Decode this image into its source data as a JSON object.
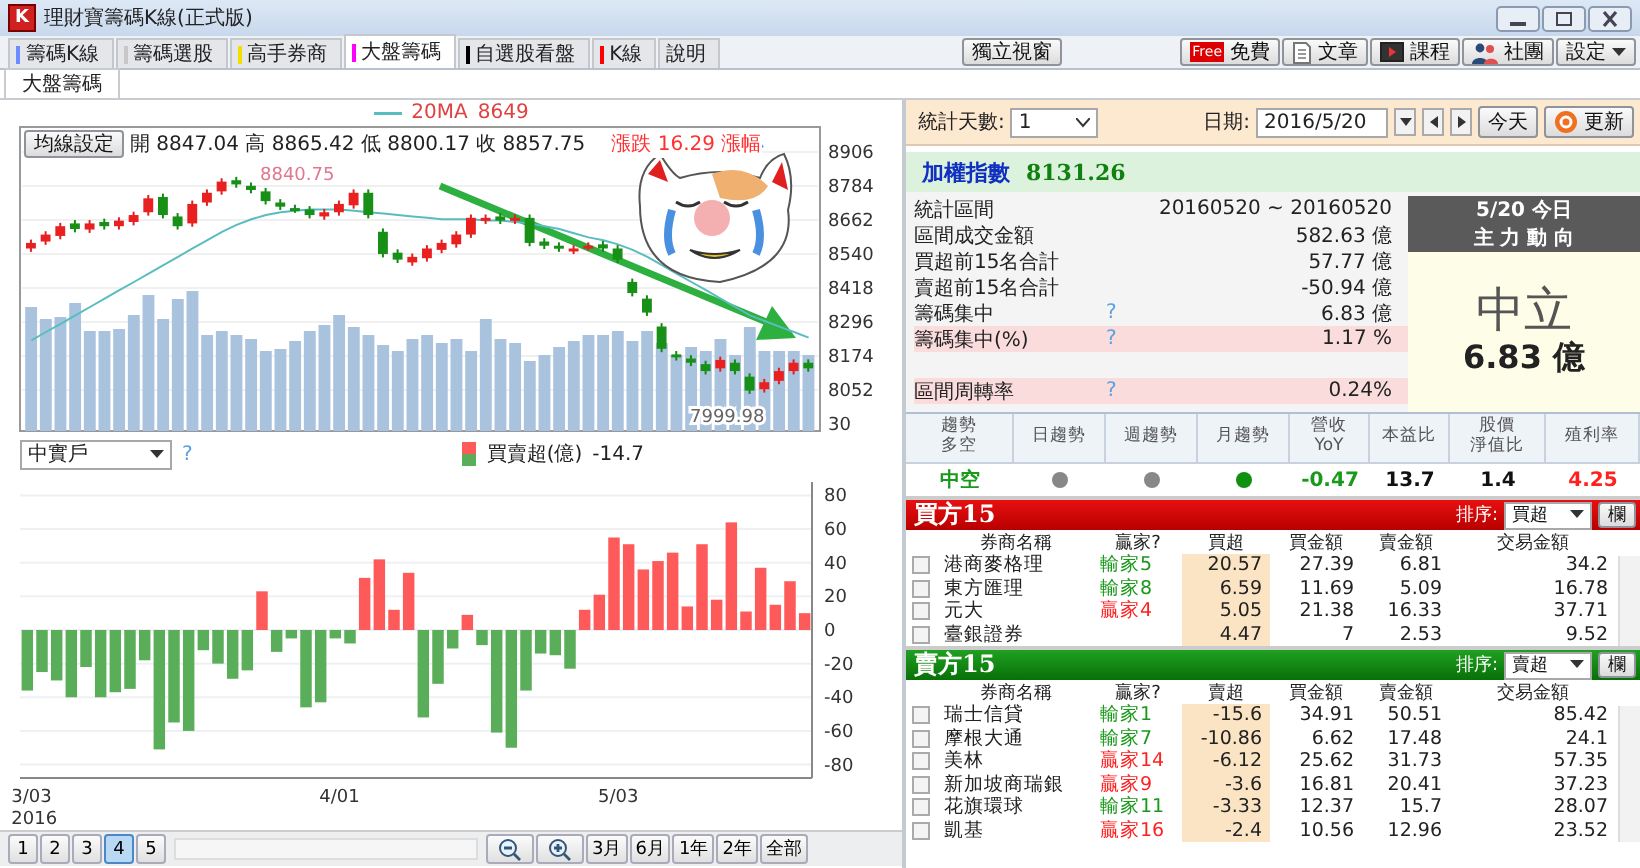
{
  "window": {
    "logo": "K",
    "title": "理財寶籌碼K線(正式版)"
  },
  "tabs": [
    {
      "label": "籌碼K線",
      "color": "#6a8cff",
      "selected": false
    },
    {
      "label": "籌碼選股",
      "color": "#c8c8c8",
      "selected": false
    },
    {
      "label": "高手券商",
      "color": "#f0e000",
      "selected": false
    },
    {
      "label": "大盤籌碼",
      "color": "#ff00ff",
      "selected": true
    },
    {
      "label": "自選股看盤",
      "color": "#000000",
      "selected": false
    },
    {
      "label": "K線",
      "color": "#ff0000",
      "selected": false
    },
    {
      "label": "說明",
      "selected": false
    }
  ],
  "popout_button": "獨立視窗",
  "toolbar_buttons": [
    {
      "kind": "free",
      "badge": "Free",
      "label": "免費"
    },
    {
      "kind": "article",
      "label": "文章"
    },
    {
      "kind": "course",
      "label": "課程"
    },
    {
      "kind": "group",
      "label": "社團"
    }
  ],
  "settings_button": "設定",
  "subtabs": [
    {
      "label": "大盤籌碼",
      "selected": true
    }
  ],
  "price_chart": {
    "legend_value": "8649",
    "settings_button": "均線設定",
    "ohlc": "開 8847.04 高 8865.42 低 8800.17 收 8857.75",
    "change": "漲跌 16.29 漲幅",
    "high_marker": "8840.75",
    "low_marker": "7999.98",
    "partial_axis_label": "30",
    "chart_data": {
      "type": "candlestick",
      "ylim": [
        7905,
        8996
      ],
      "yticks": [
        8906,
        8784,
        8662,
        8540,
        8418,
        8296,
        8174,
        8052
      ],
      "grid": true,
      "ohlc": [
        [
          8560,
          8592,
          8548,
          8580
        ],
        [
          8585,
          8622,
          8573,
          8610
        ],
        [
          8605,
          8652,
          8593,
          8640
        ],
        [
          8650,
          8662,
          8618,
          8630
        ],
        [
          8628,
          8662,
          8616,
          8650
        ],
        [
          8655,
          8667,
          8628,
          8640
        ],
        [
          8640,
          8672,
          8628,
          8660
        ],
        [
          8655,
          8692,
          8643,
          8680
        ],
        [
          8690,
          8752,
          8678,
          8740
        ],
        [
          8745,
          8757,
          8668,
          8680
        ],
        [
          8675,
          8687,
          8628,
          8640
        ],
        [
          8650,
          8732,
          8638,
          8720
        ],
        [
          8725,
          8772,
          8713,
          8760
        ],
        [
          8765,
          8812,
          8753,
          8800
        ],
        [
          8805,
          8817,
          8778,
          8790
        ],
        [
          8785,
          8797,
          8758,
          8770
        ],
        [
          8765,
          8777,
          8718,
          8730
        ],
        [
          8725,
          8737,
          8698,
          8710
        ],
        [
          8705,
          8717,
          8688,
          8700
        ],
        [
          8700,
          8712,
          8668,
          8680
        ],
        [
          8675,
          8702,
          8663,
          8690
        ],
        [
          8690,
          8732,
          8678,
          8720
        ],
        [
          8715,
          8772,
          8703,
          8760
        ],
        [
          8760,
          8772,
          8668,
          8680
        ],
        [
          8620,
          8632,
          8528,
          8540
        ],
        [
          8545,
          8557,
          8508,
          8520
        ],
        [
          8510,
          8542,
          8498,
          8530
        ],
        [
          8525,
          8572,
          8513,
          8560
        ],
        [
          8555,
          8592,
          8543,
          8580
        ],
        [
          8575,
          8622,
          8563,
          8610
        ],
        [
          8610,
          8682,
          8598,
          8670
        ],
        [
          8660,
          8682,
          8648,
          8670
        ],
        [
          8675,
          8687,
          8648,
          8660
        ],
        [
          8660,
          8682,
          8648,
          8670
        ],
        [
          8670,
          8682,
          8568,
          8580
        ],
        [
          8585,
          8597,
          8558,
          8570
        ],
        [
          8570,
          8582,
          8548,
          8560
        ],
        [
          8552,
          8572,
          8540,
          8560
        ],
        [
          8565,
          8582,
          8553,
          8570
        ],
        [
          8575,
          8587,
          8548,
          8560
        ],
        [
          8560,
          8572,
          8508,
          8520
        ],
        [
          8440,
          8452,
          8388,
          8400
        ],
        [
          8380,
          8392,
          8318,
          8330
        ],
        [
          8280,
          8292,
          8188,
          8200
        ],
        [
          8180,
          8192,
          8158,
          8170
        ],
        [
          8165,
          8177,
          8138,
          8150
        ],
        [
          8145,
          8157,
          8108,
          8120
        ],
        [
          8130,
          8172,
          8118,
          8160
        ],
        [
          8150,
          8162,
          8108,
          8120
        ],
        [
          8100,
          8112,
          8038,
          8050
        ],
        [
          8055,
          8092,
          8043,
          8080
        ],
        [
          8085,
          8132,
          8073,
          8120
        ],
        [
          8120,
          8162,
          8108,
          8150
        ],
        [
          8150,
          8162,
          8118,
          8130
        ]
      ]
    },
    "moving_average": {
      "chart_data": {
        "type": "line",
        "ylim": [
          7905,
          8996
        ],
        "series": [
          {
            "name": "20MA",
            "color": "#5bbcc0",
            "values": [
              8230,
              8260,
              8290,
              8320,
              8350,
              8380,
              8410,
              8440,
              8470,
              8500,
              8530,
              8560,
              8590,
              8620,
              8645,
              8665,
              8680,
              8690,
              8695,
              8700,
              8700,
              8700,
              8695,
              8690,
              8685,
              8680,
              8675,
              8670,
              8665,
              8665,
              8665,
              8660,
              8660,
              8655,
              8650,
              8640,
              8630,
              8615,
              8600,
              8590,
              8575,
              8555,
              8530,
              8500,
              8470,
              8440,
              8410,
              8380,
              8350,
              8320,
              8300,
              8280,
              8260,
              8240
            ]
          }
        ]
      }
    }
  },
  "flow_chart": {
    "investor_select": "中實戶",
    "help": "?",
    "legend_value": "-14.7",
    "x_labels": [
      "3/03",
      "4/01",
      "5/03"
    ],
    "year_label": "2016",
    "chart_data": {
      "type": "bar",
      "stacked": true,
      "grid": true,
      "ylim": [
        -88,
        88
      ],
      "yticks": [
        80,
        60,
        40,
        20,
        0,
        -20,
        -40,
        -60,
        -80
      ],
      "series": [
        {
          "name": "買賣超(億)",
          "color": "#ff5a5a",
          "values": [
            null,
            null,
            null,
            null,
            null,
            null,
            null,
            null,
            null,
            null,
            null,
            null,
            null,
            null,
            null,
            null,
            23,
            null,
            null,
            null,
            null,
            null,
            null,
            31,
            42,
            12,
            34,
            null,
            null,
            null,
            9,
            null,
            null,
            null,
            null,
            null,
            null,
            null,
            12,
            21,
            55,
            51,
            36,
            41,
            46,
            14,
            51,
            18,
            64,
            11,
            37,
            15,
            29,
            10
          ]
        },
        {
          "color": "#5aae5a",
          "values": [
            -36,
            -25,
            -30,
            -40,
            -22,
            -40,
            -37,
            -35,
            -18,
            -71,
            -55,
            -60,
            -12,
            -20,
            -29,
            -24,
            null,
            -13,
            -5,
            -46,
            -43,
            -5,
            -8,
            null,
            null,
            null,
            null,
            -52,
            -32,
            -11,
            null,
            -9,
            -61,
            -70,
            -36,
            -14,
            -15,
            -23,
            null,
            null,
            null,
            null,
            null,
            null,
            null,
            null,
            null,
            null,
            null,
            null,
            null,
            null,
            null,
            null
          ]
        }
      ]
    }
  },
  "pager": {
    "pages": [
      {
        "label": "1",
        "selected": false
      },
      {
        "label": "2",
        "selected": false
      },
      {
        "label": "3",
        "selected": false
      },
      {
        "label": "4",
        "selected": true
      },
      {
        "label": "5",
        "selected": false
      }
    ],
    "ranges": [
      "3月",
      "6月",
      "1年",
      "2年",
      "全部"
    ]
  },
  "filter": {
    "days_label": "統計天數:",
    "days": "1",
    "date_label": "日期:",
    "date": "2016/5/20",
    "today_button": "今天",
    "refresh_button": "更新"
  },
  "index": {
    "name": "加權指數",
    "value": "8131.26"
  },
  "stats": [
    {
      "kind": "stat",
      "label": "統計區間",
      "value": "20160520 ~ 20160520",
      "help": false,
      "highlighted": false
    },
    {
      "kind": "stat",
      "label": "區間成交金額",
      "value": "582.63 億",
      "help": false,
      "highlighted": false
    },
    {
      "kind": "stat",
      "label": "買超前15名合計",
      "value": "57.77 億",
      "help": false,
      "highlighted": false
    },
    {
      "kind": "stat",
      "label": "賣超前15名合計",
      "value": "-50.94 億",
      "help": false,
      "highlighted": false
    },
    {
      "kind": "stat",
      "label": "籌碼集中",
      "value": "6.83 億",
      "help": true,
      "highlighted": false
    },
    {
      "kind": "stat",
      "label": "籌碼集中(%)",
      "value": "1.17 %",
      "help": true,
      "highlighted": true
    },
    {
      "kind": "blank"
    },
    {
      "kind": "stat",
      "label": "區間周轉率",
      "value": "0.24%",
      "help": true,
      "highlighted": true
    }
  ],
  "help_mark": "?",
  "mainforce": {
    "date": "5/20 今日",
    "title": "主 力 動 向",
    "verdict": "中立",
    "amount": "6.83 億"
  },
  "indicators": {
    "headers": [
      [
        "趨勢",
        "多空"
      ],
      [
        "日趨勢"
      ],
      [
        "週趨勢"
      ],
      [
        "月趨勢"
      ],
      [
        "營收",
        "YoY"
      ],
      [
        "本益比"
      ],
      [
        "股價",
        "淨值比"
      ],
      [
        "殖利率"
      ]
    ],
    "values": [
      {
        "kind": "text",
        "text": "中空",
        "color": "#1a9a1a"
      },
      {
        "kind": "dot",
        "color": "#888888"
      },
      {
        "kind": "dot",
        "color": "#888888"
      },
      {
        "kind": "dot",
        "color": "#109010"
      },
      {
        "kind": "text",
        "text": "-0.47",
        "color": "#1a9a1a"
      },
      {
        "kind": "text",
        "text": "13.7",
        "color": "#111111"
      },
      {
        "kind": "text",
        "text": "1.4",
        "color": "#111111"
      },
      {
        "kind": "text",
        "text": "4.25",
        "color": "#ff2020"
      }
    ]
  },
  "tables": [
    {
      "kind": "buy",
      "title": "買方15",
      "sort_label": "排序:",
      "sort": "買超",
      "columns_button": "欄",
      "columns": [
        "券商名稱",
        "贏家?",
        "買超",
        "買金額",
        "賣金額",
        "交易金額"
      ],
      "rows": [
        {
          "checked": false,
          "broker": "港商麥格理",
          "tag": "輸家5",
          "winner": false,
          "net": "20.57",
          "buy": "27.39",
          "sell": "6.81",
          "total": "34.2"
        },
        {
          "checked": false,
          "broker": "東方匯理",
          "tag": "輸家8",
          "winner": false,
          "net": "6.59",
          "buy": "11.69",
          "sell": "5.09",
          "total": "16.78"
        },
        {
          "checked": false,
          "broker": "元大",
          "tag": "贏家4",
          "winner": true,
          "net": "5.05",
          "buy": "21.38",
          "sell": "16.33",
          "total": "37.71"
        },
        {
          "checked": false,
          "broker": "臺銀證券",
          "net": "4.47",
          "buy": "7",
          "sell": "2.53",
          "total": "9.52"
        }
      ]
    },
    {
      "kind": "sell",
      "title": "賣方15",
      "sort_label": "排序:",
      "sort": "賣超",
      "columns_button": "欄",
      "columns": [
        "券商名稱",
        "贏家?",
        "賣超",
        "買金額",
        "賣金額",
        "交易金額"
      ],
      "rows": [
        {
          "checked": false,
          "broker": "瑞士信貸",
          "tag": "輸家1",
          "winner": false,
          "net": "-15.6",
          "buy": "34.91",
          "sell": "50.51",
          "total": "85.42"
        },
        {
          "checked": false,
          "broker": "摩根大通",
          "tag": "輸家7",
          "winner": false,
          "net": "-10.86",
          "buy": "6.62",
          "sell": "17.48",
          "total": "24.1"
        },
        {
          "checked": false,
          "broker": "美林",
          "tag": "贏家14",
          "winner": true,
          "net": "-6.12",
          "buy": "25.62",
          "sell": "31.73",
          "total": "57.35"
        },
        {
          "checked": false,
          "broker": "新加坡商瑞銀",
          "tag": "贏家9",
          "winner": true,
          "net": "-3.6",
          "buy": "16.81",
          "sell": "20.41",
          "total": "37.23"
        },
        {
          "checked": false,
          "broker": "花旗環球",
          "tag": "輸家11",
          "winner": false,
          "net": "-3.33",
          "buy": "12.37",
          "sell": "15.7",
          "total": "28.07"
        },
        {
          "checked": false,
          "broker": "凱基",
          "tag": "贏家16",
          "winner": true,
          "net": "-2.4",
          "buy": "10.56",
          "sell": "12.96",
          "total": "23.52"
        }
      ]
    }
  ]
}
